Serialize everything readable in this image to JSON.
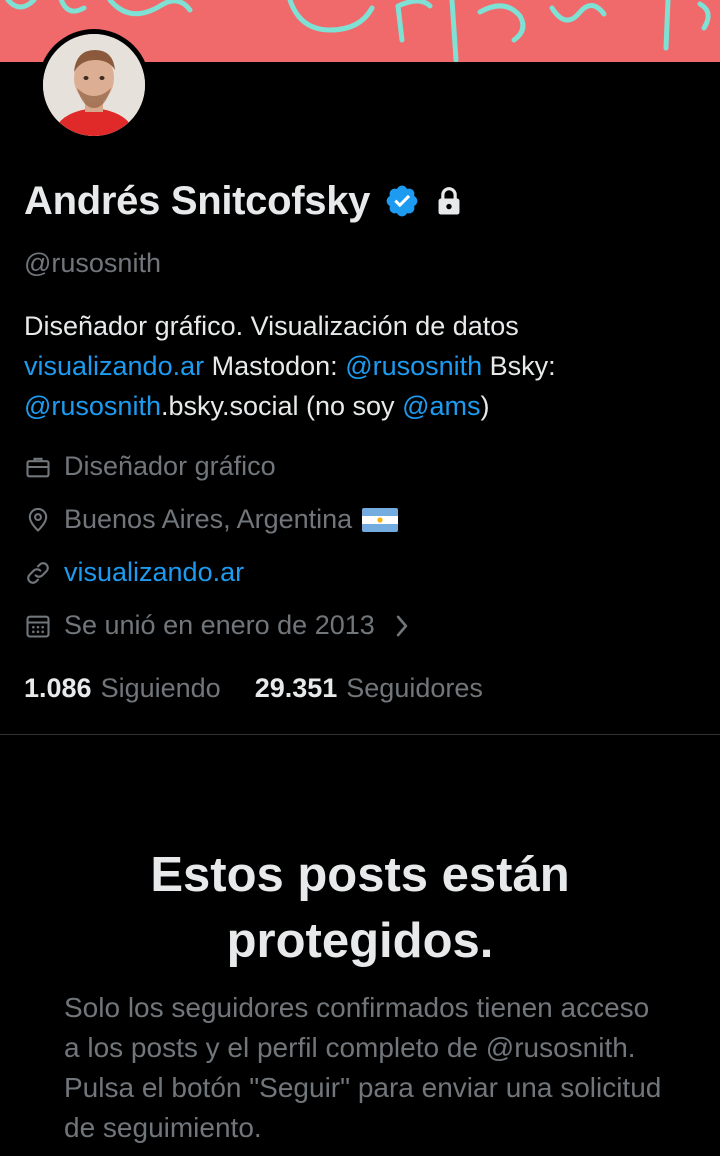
{
  "profile": {
    "name": "Andrés Snitcofsky",
    "handle": "@rusosnith",
    "bio": {
      "line1": "Diseñador gráfico. Visualización de datos",
      "site_link": "visualizando.ar",
      "mastodon_label": " Mastodon: ",
      "mastodon_handle": "@rusosnith",
      "bsky_label": " Bsky:",
      "bsky_handle": "@rusosnith",
      "bsky_suffix": ".bsky.social (no soy ",
      "ams_handle": "@ams",
      "closing": ")"
    },
    "profession": "Diseñador gráfico",
    "location": "Buenos Aires, Argentina",
    "website": "visualizando.ar",
    "joined": "Se unió en enero de 2013"
  },
  "stats": {
    "following_count": "1.086",
    "following_label": "Siguiendo",
    "followers_count": "29.351",
    "followers_label": "Seguidores"
  },
  "protected": {
    "title": "Estos posts están protegidos.",
    "text": "Solo los seguidores confirmados tienen acceso a los posts y el perfil completo de @rusosnith. Pulsa el botón \"Seguir\" para enviar una solicitud de seguimiento."
  },
  "colors": {
    "accent": "#1d9bf0",
    "banner": "#f06a6c",
    "muted": "#71767b"
  },
  "icons": [
    "verified-badge-icon",
    "lock-icon",
    "briefcase-icon",
    "location-pin-icon",
    "link-icon",
    "calendar-icon",
    "chevron-right-icon",
    "argentina-flag-icon"
  ]
}
